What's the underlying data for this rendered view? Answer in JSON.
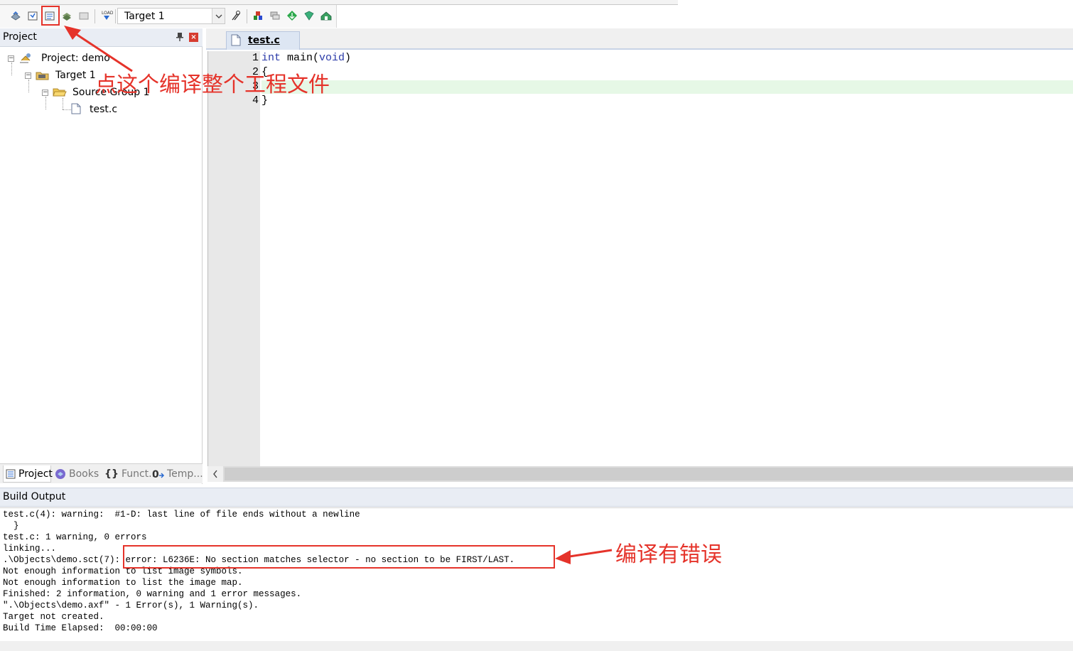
{
  "toolbar": {
    "buttons": [
      "translate-icon",
      "build-icon",
      "rebuild-icon",
      "batch-build-icon",
      "stop-build-icon",
      "download-icon"
    ],
    "target_select": {
      "value": "Target 1"
    },
    "right_buttons": [
      "options-for-target-icon",
      "manage-components-icon",
      "select-packs-icon",
      "pack-installer-icon",
      "manage-run-time-icon",
      "env-icon"
    ]
  },
  "project_panel": {
    "title": "Project",
    "tree": {
      "project": "Project: demo",
      "target": "Target 1",
      "group": "Source Group 1",
      "file": "test.c"
    },
    "tabs": [
      "Project",
      "Books",
      "Funct...",
      "Temp..."
    ]
  },
  "editor": {
    "tab": "test.c",
    "line_numbers": [
      "1",
      "2",
      "3",
      "4"
    ],
    "line1": {
      "kw1": "int",
      "mid": " main(",
      "kw2": "void",
      "end": ")"
    },
    "line2": "{",
    "line3": "",
    "line4": "}"
  },
  "build_output": {
    "title": "Build Output",
    "lines": [
      "test.c(4): warning:  #1-D: last line of file ends without a newline",
      "  }",
      "test.c: 1 warning, 0 errors",
      "linking...",
      ".\\Objects\\demo.sct(7): error: L6236E: No section matches selector - no section to be FIRST/LAST.",
      "Not enough information to list image symbols.",
      "Not enough information to list the image map.",
      "Finished: 2 information, 0 warning and 1 error messages.",
      "\".\\Objects\\demo.axf\" - 1 Error(s), 1 Warning(s).",
      "Target not created.",
      "Build Time Elapsed:  00:00:00"
    ]
  },
  "annotations": {
    "build_note": "点这个编译整个工程文件",
    "error_note": "编译有错误",
    "color": "#e5332a"
  }
}
